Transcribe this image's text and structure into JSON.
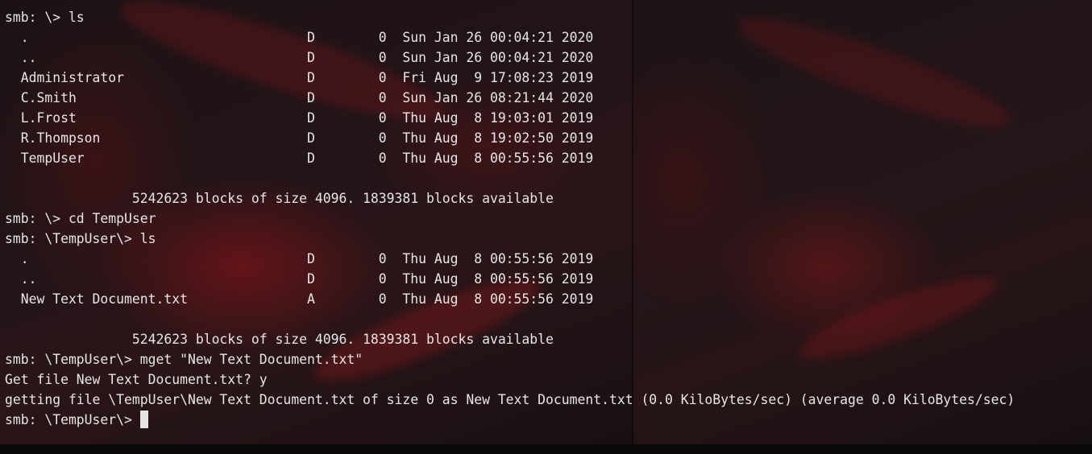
{
  "colors": {
    "text": "#e6e6e6",
    "background": "#140d0f",
    "cursor": "#e6e6e6"
  },
  "terminal": {
    "lines": [
      "smb: \\> ls",
      "  .                                   D        0  Sun Jan 26 00:04:21 2020",
      "  ..                                  D        0  Sun Jan 26 00:04:21 2020",
      "  Administrator                       D        0  Fri Aug  9 17:08:23 2019",
      "  C.Smith                             D        0  Sun Jan 26 08:21:44 2020",
      "  L.Frost                             D        0  Thu Aug  8 19:03:01 2019",
      "  R.Thompson                          D        0  Thu Aug  8 19:02:50 2019",
      "  TempUser                            D        0  Thu Aug  8 00:55:56 2019",
      "",
      "                5242623 blocks of size 4096. 1839381 blocks available",
      "smb: \\> cd TempUser",
      "smb: \\TempUser\\> ls",
      "  .                                   D        0  Thu Aug  8 00:55:56 2019",
      "  ..                                  D        0  Thu Aug  8 00:55:56 2019",
      "  New Text Document.txt               A        0  Thu Aug  8 00:55:56 2019",
      "",
      "                5242623 blocks of size 4096. 1839381 blocks available",
      "smb: \\TempUser\\> mget \"New Text Document.txt\"",
      "Get file New Text Document.txt? y",
      "getting file \\TempUser\\New Text Document.txt of size 0 as New Text Document.txt (0.0 KiloBytes/sec) (average 0.0 KiloBytes/sec)"
    ],
    "prompt": "smb: \\TempUser\\> "
  }
}
